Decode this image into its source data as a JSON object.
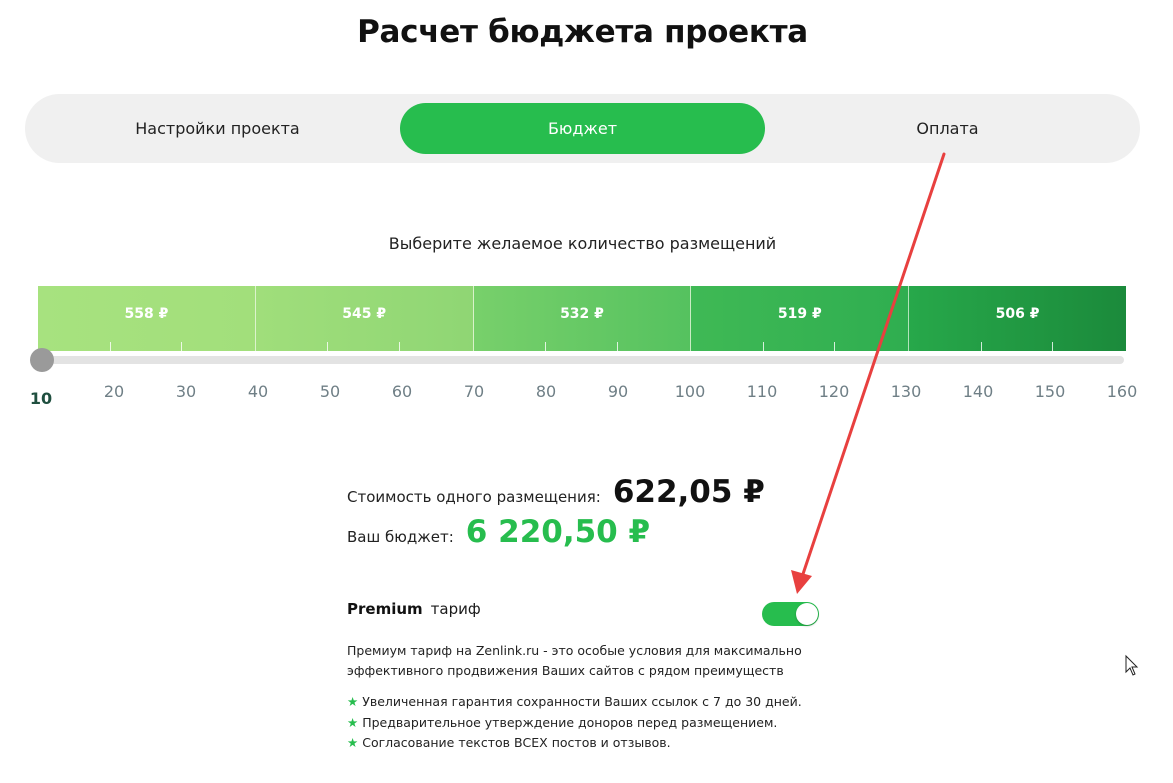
{
  "title": "Расчет бюджета проекта",
  "tabs": [
    {
      "label": "Настройки проекта"
    },
    {
      "label": "Бюджет"
    },
    {
      "label": "Оплата"
    }
  ],
  "active_tab": "Бюджет",
  "subtitle": "Выберите желаемое количество размещений",
  "price_bands": [
    {
      "price": "558 ₽"
    },
    {
      "price": "545 ₽"
    },
    {
      "price": "532 ₽"
    },
    {
      "price": "519 ₽"
    },
    {
      "price": "506 ₽"
    }
  ],
  "slider": {
    "min": 10,
    "max": 160,
    "value": 10,
    "labels": [
      "10",
      "20",
      "30",
      "40",
      "50",
      "60",
      "70",
      "80",
      "90",
      "100",
      "110",
      "120",
      "130",
      "140",
      "150",
      "160"
    ]
  },
  "cost": {
    "label": "Стоимость одного размещения:",
    "value": "622,05 ₽"
  },
  "budget": {
    "label": "Ваш бюджет:",
    "value": "6 220,50 ₽"
  },
  "premium": {
    "name": "Premium",
    "suffix": "тариф",
    "enabled": true,
    "description_line1": "Премиум тариф на Zenlink.ru - это особые условия для максимально",
    "description_line2": "эффективного продвижения Ваших сайтов с рядом преимуществ",
    "features": [
      "Увеличенная гарантия сохранности Ваших ссылок с 7 до 30 дней.",
      "Предварительное утверждение доноров перед размещением.",
      "Согласование текстов ВСЕХ постов и отзывов."
    ]
  },
  "colors": {
    "accent": "#27bd4e",
    "tab_bg": "#f0f0f0",
    "arrow": "#e8403f"
  },
  "icons": {
    "feature_marker": "star-icon",
    "cursor": "mouse-pointer-icon",
    "annotation": "red-arrow-annotation"
  }
}
